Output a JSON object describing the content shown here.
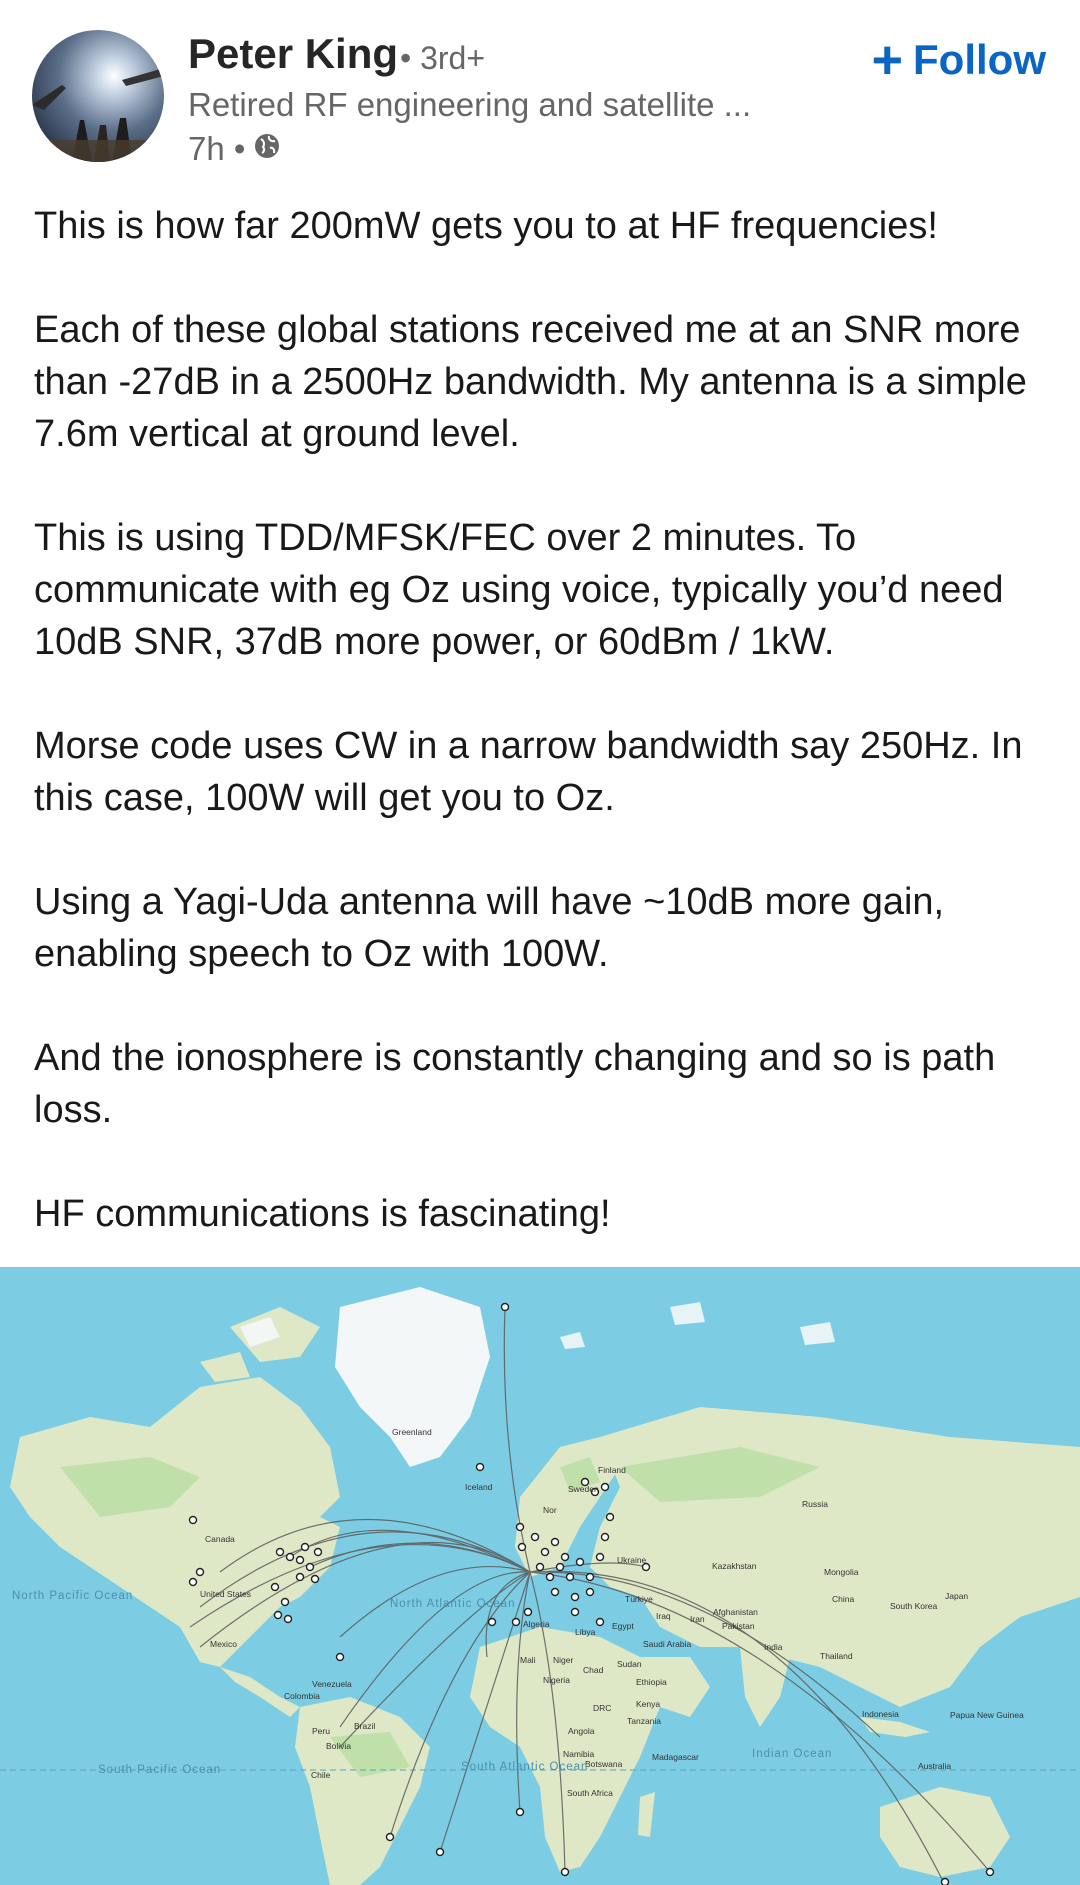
{
  "post": {
    "author": {
      "name": "Peter King",
      "degree": "• 3rd+",
      "headline": "Retired RF engineering and satellite ...",
      "time": "7h •",
      "visibility_icon": "globe-icon"
    },
    "follow": {
      "icon": "plus-icon",
      "label": "Follow"
    },
    "paragraphs": [
      "This is how far 200mW gets you to at HF frequencies!",
      "Each of these global stations received me at an SNR more than -27dB in a 2500Hz bandwidth. My antenna is a simple 7.6m vertical at ground level.",
      "This is using TDD/MFSK/FEC over 2 minutes.  To communicate with eg Oz using voice, typically you’d need 10dB SNR, 37dB more power, or 60dBm / 1kW.",
      "Morse code uses CW in a narrow bandwidth say 250Hz. In this case, 100W will get you to Oz.",
      "Using a Yagi-Uda antenna will have ~10dB more gain, enabling speech to Oz with 100W.",
      "And the ionosphere is constantly changing and so is path loss.",
      "HF communications is fascinating!"
    ]
  },
  "map": {
    "colors": {
      "ocean": "#7ccde3",
      "land": "#dfe8c6",
      "forest": "#bfe0a8",
      "ice": "#f4f7f8",
      "path": "#555555"
    },
    "labels": {
      "greenland": "Greenland",
      "iceland": "Iceland",
      "finland": "Finland",
      "sweden": "Sweden",
      "norway": "Nor",
      "russia": "Russia",
      "canada": "Canada",
      "united_states": "United States",
      "mexico": "Mexico",
      "ukraine": "Ukraine",
      "kazakhstan": "Kazakhstan",
      "mongolia": "Mongolia",
      "china": "China",
      "japan": "Japan",
      "south_korea": "South Korea",
      "turkiye": "Türkiye",
      "iraq": "Iraq",
      "iran": "Iran",
      "afghanistan": "Afghanistan",
      "pakistan": "Pakistan",
      "algeria": "Algeria",
      "libya": "Libya",
      "egypt": "Egypt",
      "saudi_arabia": "Saudi Arabia",
      "india": "India",
      "thailand": "Thailand",
      "mali": "Mali",
      "niger": "Niger",
      "chad": "Chad",
      "sudan": "Sudan",
      "nigeria": "Nigeria",
      "ethiopia": "Ethiopia",
      "venezuela": "Venezuela",
      "colombia": "Colombia",
      "kenya": "Kenya",
      "drc": "DRC",
      "tanzania": "Tanzania",
      "indonesia": "Indonesia",
      "papua": "Papua New Guinea",
      "peru": "Peru",
      "brazil": "Brazil",
      "bolivia": "Bolivia",
      "angola": "Angola",
      "namibia": "Namibia",
      "madagascar": "Madagascar",
      "botswana": "Botswana",
      "chile": "Chile",
      "australia": "Australia",
      "south_africa": "South Africa",
      "north_pacific": "North Pacific Ocean",
      "north_atlantic": "North Atlantic Ocean",
      "indian_ocean": "Indian Ocean",
      "south_pacific": "South Pacific Ocean",
      "south_atlantic": "South Atlantic Ocean"
    }
  }
}
